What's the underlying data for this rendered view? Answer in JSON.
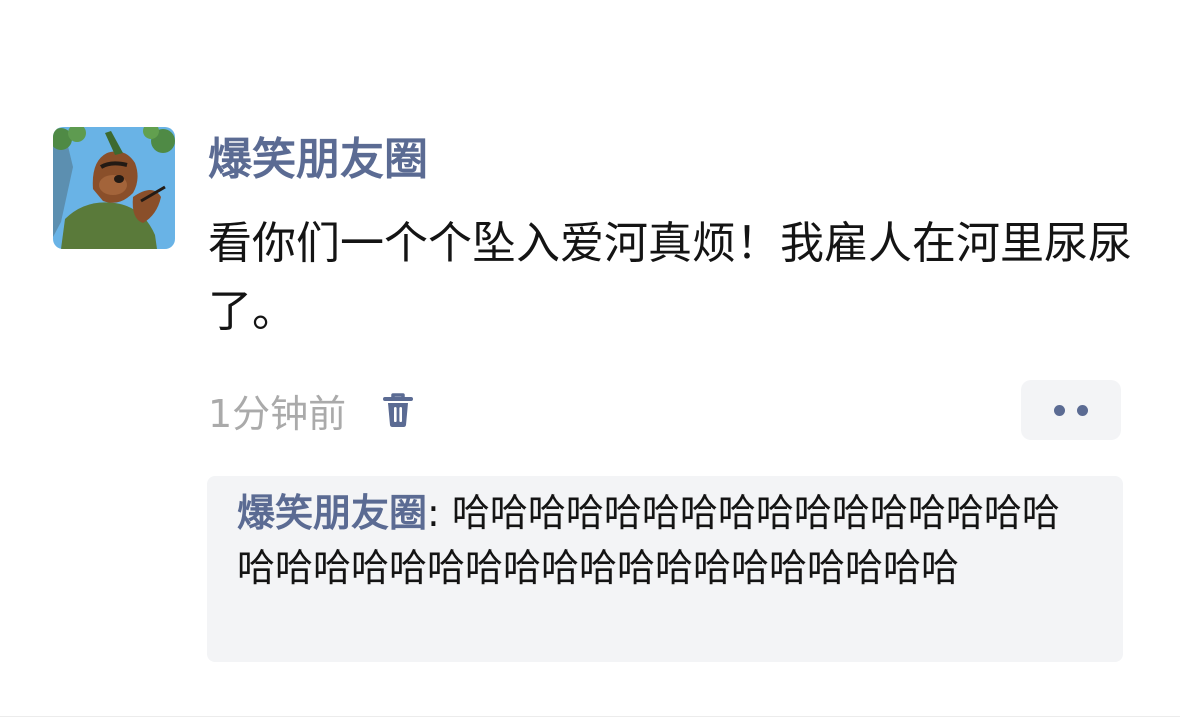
{
  "post": {
    "author": "爆笑朋友圈",
    "content": "看你们一个个坠入爱河真烦！我雇人在河里尿尿了。",
    "timestamp": "1分钟前"
  },
  "icons": {
    "avatar": "cartoon-bear-avatar",
    "delete": "trash-icon",
    "more": "more-dots-icon"
  },
  "comments": [
    {
      "author": "爆笑朋友圈",
      "separator": ": ",
      "text": "哈哈哈哈哈哈哈哈哈哈哈哈哈哈哈哈哈哈哈哈哈哈哈哈哈哈哈哈哈哈哈哈哈哈哈"
    }
  ],
  "colors": {
    "name": "#5b6b93",
    "text": "#141414",
    "timestamp": "#aaaaaa",
    "panel": "#f3f4f6"
  }
}
